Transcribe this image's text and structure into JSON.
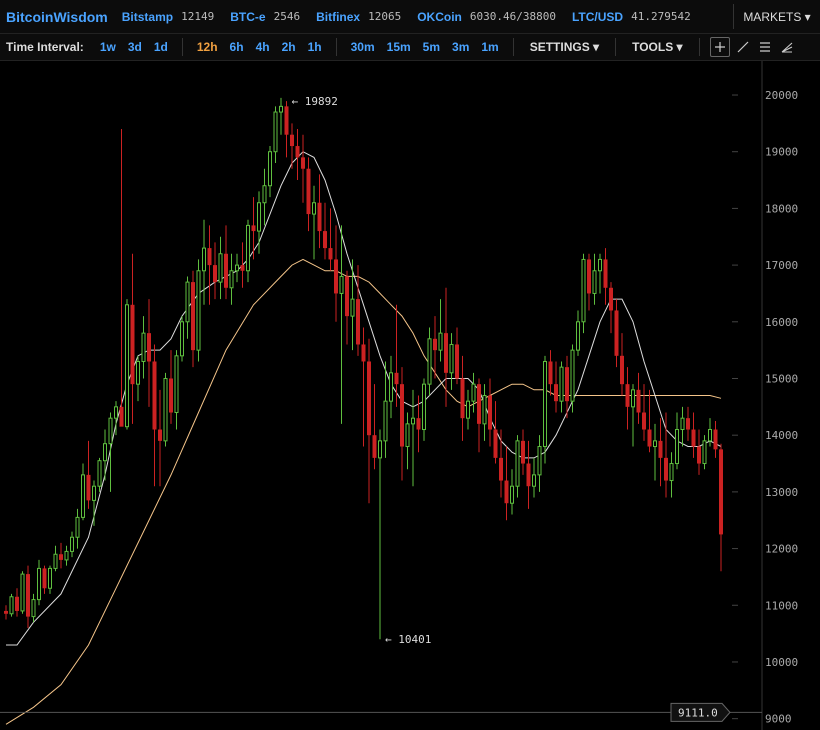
{
  "header": {
    "brand": "BitcoinWisdom",
    "tickers": [
      {
        "exchange": "Bitstamp",
        "value": "12149"
      },
      {
        "exchange": "BTC-e",
        "value": "2546"
      },
      {
        "exchange": "Bitfinex",
        "value": "12065"
      },
      {
        "exchange": "OKCoin",
        "value": "6030.46/38800"
      },
      {
        "exchange": "LTC/USD",
        "value": "41.279542"
      }
    ],
    "markets_label": "MARKETS ▾"
  },
  "toolbar": {
    "time_interval_label": "Time Interval:",
    "intervals_a": [
      "1w",
      "3d",
      "1d"
    ],
    "intervals_b": [
      "12h",
      "6h",
      "4h",
      "2h",
      "1h"
    ],
    "intervals_c": [
      "30m",
      "15m",
      "5m",
      "3m",
      "1m"
    ],
    "selected": "12h",
    "settings_label": "SETTINGS ▾",
    "tools_label": "TOOLS ▾",
    "tool_icons": [
      "crosshair-icon",
      "line-draw-icon",
      "horizontal-lines-icon",
      "fan-icon"
    ]
  },
  "chart_data": {
    "type": "candlestick",
    "ylim": [
      8800,
      20600
    ],
    "yticks": [
      9000,
      10000,
      11000,
      12000,
      13000,
      14000,
      15000,
      16000,
      17000,
      18000,
      19000,
      20000
    ],
    "current_price_label": "9111.0",
    "current_price": 9111,
    "high_annotation": {
      "label": "← 19892",
      "value": 19892
    },
    "low_annotation": {
      "label": "← 10401",
      "value": 10401
    },
    "colors": {
      "up": "#5fbf3f",
      "down": "#cc2222",
      "ma_fast": "#dddddd",
      "ma_slow": "#f5c58a"
    },
    "candles": [
      [
        10900,
        11000,
        10750,
        10850
      ],
      [
        10850,
        11200,
        10800,
        11150
      ],
      [
        11150,
        11300,
        10800,
        10900
      ],
      [
        10900,
        11600,
        10850,
        11550
      ],
      [
        11550,
        11700,
        10600,
        10800
      ],
      [
        10800,
        11200,
        10700,
        11100
      ],
      [
        11100,
        11800,
        11000,
        11650
      ],
      [
        11650,
        11700,
        11200,
        11300
      ],
      [
        11300,
        11700,
        11200,
        11650
      ],
      [
        11650,
        12050,
        11600,
        11900
      ],
      [
        11900,
        12100,
        11650,
        11800
      ],
      [
        11800,
        12050,
        11700,
        11950
      ],
      [
        11950,
        12300,
        11850,
        12200
      ],
      [
        12200,
        12700,
        12000,
        12550
      ],
      [
        12550,
        13500,
        12500,
        13300
      ],
      [
        13300,
        13900,
        12700,
        12850
      ],
      [
        12850,
        13200,
        12400,
        13100
      ],
      [
        13100,
        13600,
        13000,
        13550
      ],
      [
        13550,
        14100,
        13200,
        13850
      ],
      [
        13850,
        14400,
        13000,
        14300
      ],
      [
        14300,
        14600,
        14000,
        14500
      ],
      [
        14500,
        19400,
        14200,
        14150
      ],
      [
        14150,
        16400,
        14100,
        16300
      ],
      [
        16300,
        17200,
        14200,
        14900
      ],
      [
        14900,
        15400,
        14600,
        15300
      ],
      [
        15300,
        16100,
        15000,
        15800
      ],
      [
        15800,
        16400,
        14500,
        15300
      ],
      [
        15300,
        15600,
        13100,
        14100
      ],
      [
        14100,
        14800,
        13100,
        13900
      ],
      [
        13900,
        15100,
        13800,
        15000
      ],
      [
        15000,
        15500,
        14200,
        14400
      ],
      [
        14400,
        15500,
        14100,
        15400
      ],
      [
        15400,
        16100,
        15300,
        16000
      ],
      [
        16000,
        16800,
        15700,
        16700
      ],
      [
        16700,
        16900,
        15200,
        15500
      ],
      [
        15500,
        17100,
        15300,
        16900
      ],
      [
        16900,
        17800,
        16300,
        17300
      ],
      [
        17300,
        17700,
        16300,
        17000
      ],
      [
        17000,
        17400,
        16400,
        16700
      ],
      [
        16700,
        17500,
        16400,
        17200
      ],
      [
        17200,
        17700,
        16400,
        16600
      ],
      [
        16600,
        17200,
        16300,
        16900
      ],
      [
        16900,
        17200,
        16700,
        17000
      ],
      [
        17000,
        17400,
        16600,
        16900
      ],
      [
        16900,
        17800,
        16700,
        17700
      ],
      [
        17700,
        18200,
        17100,
        17600
      ],
      [
        17600,
        18300,
        17200,
        18100
      ],
      [
        18100,
        18700,
        17700,
        18400
      ],
      [
        18400,
        19100,
        18200,
        19000
      ],
      [
        19000,
        19800,
        18800,
        19700
      ],
      [
        19700,
        19950,
        19300,
        19800
      ],
      [
        19800,
        19892,
        18900,
        19300
      ],
      [
        19300,
        19500,
        18700,
        19100
      ],
      [
        19100,
        19400,
        18500,
        18900
      ],
      [
        18900,
        19300,
        18100,
        18700
      ],
      [
        18700,
        18900,
        17600,
        17900
      ],
      [
        17900,
        18400,
        17100,
        18100
      ],
      [
        18100,
        18600,
        17300,
        17600
      ],
      [
        17600,
        18100,
        17100,
        17300
      ],
      [
        17300,
        18000,
        16900,
        17100
      ],
      [
        17100,
        17700,
        16000,
        16500
      ],
      [
        16500,
        17700,
        14200,
        16800
      ],
      [
        16800,
        16900,
        15600,
        16100
      ],
      [
        16100,
        17100,
        15500,
        16400
      ],
      [
        16400,
        17000,
        15400,
        15600
      ],
      [
        15600,
        15900,
        13800,
        15300
      ],
      [
        15300,
        15700,
        12800,
        14000
      ],
      [
        14000,
        14900,
        13400,
        13600
      ],
      [
        13600,
        14100,
        10401,
        13900
      ],
      [
        13900,
        15300,
        13600,
        14600
      ],
      [
        14600,
        15400,
        14300,
        15100
      ],
      [
        15100,
        16300,
        14500,
        14900
      ],
      [
        14900,
        15200,
        13200,
        13800
      ],
      [
        13800,
        14400,
        13400,
        14200
      ],
      [
        14200,
        14800,
        13100,
        14300
      ],
      [
        14300,
        14700,
        13700,
        14100
      ],
      [
        14100,
        15000,
        13900,
        14900
      ],
      [
        14900,
        15900,
        14700,
        15700
      ],
      [
        15700,
        16100,
        15000,
        15500
      ],
      [
        15500,
        16400,
        15300,
        15800
      ],
      [
        15800,
        16600,
        14500,
        15100
      ],
      [
        15100,
        15800,
        14800,
        15600
      ],
      [
        15600,
        15900,
        14900,
        15000
      ],
      [
        15000,
        15400,
        13900,
        14300
      ],
      [
        14300,
        14800,
        14100,
        14600
      ],
      [
        14600,
        15100,
        14400,
        14900
      ],
      [
        14900,
        15000,
        13700,
        14200
      ],
      [
        14200,
        14900,
        13900,
        14700
      ],
      [
        14700,
        15000,
        13800,
        14100
      ],
      [
        14100,
        14600,
        13500,
        13600
      ],
      [
        13600,
        14100,
        12900,
        13200
      ],
      [
        13200,
        13800,
        12500,
        12800
      ],
      [
        12800,
        13400,
        12600,
        13100
      ],
      [
        13100,
        14000,
        12900,
        13900
      ],
      [
        13900,
        14100,
        13300,
        13500
      ],
      [
        13500,
        13900,
        12700,
        13100
      ],
      [
        13100,
        13600,
        12900,
        13300
      ],
      [
        13300,
        14000,
        13000,
        13800
      ],
      [
        13800,
        15400,
        13500,
        15300
      ],
      [
        15300,
        15500,
        14700,
        14900
      ],
      [
        14900,
        15300,
        14400,
        14600
      ],
      [
        14600,
        15300,
        14400,
        15200
      ],
      [
        15200,
        15400,
        14300,
        14600
      ],
      [
        14600,
        15600,
        14400,
        15500
      ],
      [
        15500,
        16200,
        15400,
        16000
      ],
      [
        16000,
        17200,
        15800,
        17100
      ],
      [
        17100,
        17200,
        16200,
        16500
      ],
      [
        16500,
        17200,
        16300,
        16900
      ],
      [
        16900,
        17200,
        16500,
        17100
      ],
      [
        17100,
        17300,
        16300,
        16600
      ],
      [
        16600,
        16700,
        15800,
        16200
      ],
      [
        16200,
        16400,
        15200,
        15400
      ],
      [
        15400,
        15800,
        14700,
        14900
      ],
      [
        14900,
        15200,
        14100,
        14500
      ],
      [
        14500,
        14900,
        13800,
        14800
      ],
      [
        14800,
        15100,
        14200,
        14400
      ],
      [
        14400,
        14900,
        13900,
        14100
      ],
      [
        14100,
        14800,
        13700,
        13800
      ],
      [
        13800,
        14200,
        13200,
        13900
      ],
      [
        13900,
        14300,
        13100,
        13600
      ],
      [
        13600,
        14400,
        12900,
        13200
      ],
      [
        13200,
        13700,
        12900,
        13500
      ],
      [
        13500,
        14400,
        13400,
        14100
      ],
      [
        14100,
        14500,
        13800,
        14300
      ],
      [
        14300,
        14500,
        13900,
        14100
      ],
      [
        14100,
        14400,
        13600,
        13800
      ],
      [
        13800,
        14100,
        13300,
        13500
      ],
      [
        13500,
        14000,
        13400,
        13900
      ],
      [
        13900,
        14300,
        13800,
        14100
      ],
      [
        14100,
        14250,
        13600,
        13750
      ],
      [
        13750,
        13850,
        11600,
        12250
      ]
    ],
    "ma_fast": [
      [
        0,
        10300
      ],
      [
        2,
        10300
      ],
      [
        5,
        10700
      ],
      [
        10,
        11200
      ],
      [
        15,
        12200
      ],
      [
        18,
        13300
      ],
      [
        20,
        14200
      ],
      [
        22,
        14900
      ],
      [
        24,
        15400
      ],
      [
        26,
        15500
      ],
      [
        28,
        15500
      ],
      [
        30,
        15700
      ],
      [
        32,
        16100
      ],
      [
        35,
        16500
      ],
      [
        38,
        16700
      ],
      [
        40,
        16800
      ],
      [
        42,
        16900
      ],
      [
        44,
        17100
      ],
      [
        46,
        17400
      ],
      [
        48,
        17900
      ],
      [
        50,
        18400
      ],
      [
        52,
        18800
      ],
      [
        54,
        19000
      ],
      [
        56,
        18900
      ],
      [
        58,
        18500
      ],
      [
        60,
        17900
      ],
      [
        62,
        17200
      ],
      [
        64,
        16600
      ],
      [
        66,
        16000
      ],
      [
        68,
        15400
      ],
      [
        70,
        14900
      ],
      [
        72,
        14600
      ],
      [
        74,
        14500
      ],
      [
        76,
        14600
      ],
      [
        78,
        14800
      ],
      [
        80,
        15000
      ],
      [
        82,
        15000
      ],
      [
        84,
        15000
      ],
      [
        86,
        14800
      ],
      [
        88,
        14300
      ],
      [
        90,
        13900
      ],
      [
        92,
        13700
      ],
      [
        94,
        13600
      ],
      [
        96,
        13600
      ],
      [
        98,
        13700
      ],
      [
        100,
        14000
      ],
      [
        102,
        14400
      ],
      [
        104,
        14800
      ],
      [
        106,
        15400
      ],
      [
        108,
        16000
      ],
      [
        110,
        16400
      ],
      [
        112,
        16400
      ],
      [
        114,
        16000
      ],
      [
        116,
        15300
      ],
      [
        118,
        14700
      ],
      [
        120,
        14100
      ],
      [
        122,
        13900
      ],
      [
        124,
        13800
      ],
      [
        126,
        13800
      ],
      [
        128,
        13900
      ],
      [
        130,
        13800
      ]
    ],
    "ma_slow": [
      [
        0,
        8900
      ],
      [
        5,
        9200
      ],
      [
        10,
        9600
      ],
      [
        15,
        10300
      ],
      [
        20,
        11300
      ],
      [
        25,
        12300
      ],
      [
        30,
        13300
      ],
      [
        35,
        14400
      ],
      [
        40,
        15500
      ],
      [
        45,
        16300
      ],
      [
        50,
        16800
      ],
      [
        52,
        17000
      ],
      [
        54,
        17100
      ],
      [
        56,
        17000
      ],
      [
        58,
        16900
      ],
      [
        60,
        16900
      ],
      [
        62,
        16800
      ],
      [
        64,
        16800
      ],
      [
        66,
        16700
      ],
      [
        68,
        16500
      ],
      [
        70,
        16300
      ],
      [
        72,
        16100
      ],
      [
        74,
        15800
      ],
      [
        76,
        15400
      ],
      [
        78,
        15100
      ],
      [
        80,
        14800
      ],
      [
        82,
        14600
      ],
      [
        84,
        14500
      ],
      [
        86,
        14600
      ],
      [
        88,
        14700
      ],
      [
        90,
        14800
      ],
      [
        92,
        14900
      ],
      [
        94,
        14900
      ],
      [
        96,
        14800
      ],
      [
        98,
        14800
      ],
      [
        100,
        14700
      ],
      [
        102,
        14700
      ],
      [
        104,
        14700
      ],
      [
        106,
        14700
      ],
      [
        108,
        14700
      ],
      [
        110,
        14700
      ],
      [
        112,
        14700
      ],
      [
        114,
        14700
      ],
      [
        116,
        14700
      ],
      [
        118,
        14700
      ],
      [
        120,
        14700
      ],
      [
        122,
        14700
      ],
      [
        124,
        14700
      ],
      [
        126,
        14700
      ],
      [
        128,
        14700
      ],
      [
        130,
        14650
      ]
    ]
  }
}
